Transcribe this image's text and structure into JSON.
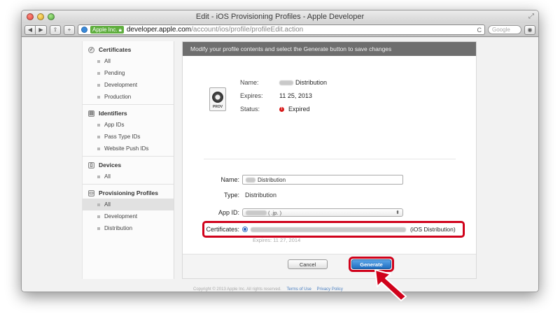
{
  "window": {
    "title": "Edit - iOS Provisioning Profiles - Apple Developer"
  },
  "toolbar": {
    "back_icon": "◀",
    "forward_icon": "▶",
    "share_icon": "⇧",
    "add_icon": "+",
    "ssl_org": "Apple Inc.",
    "url_host": "developer.apple.com",
    "url_path": "/account/ios/profile/profileEdit.action",
    "reload_icon": "C",
    "search_placeholder": "Google",
    "reader_icon": "◉"
  },
  "sidebar": {
    "sections": [
      {
        "title": "Certificates",
        "icon": "certificate-icon",
        "items": [
          "All",
          "Pending",
          "Development",
          "Production"
        ]
      },
      {
        "title": "Identifiers",
        "icon": "id-icon",
        "items": [
          "App IDs",
          "Pass Type IDs",
          "Website Push IDs"
        ]
      },
      {
        "title": "Devices",
        "icon": "device-icon",
        "items": [
          "All"
        ]
      },
      {
        "title": "Provisioning Profiles",
        "icon": "profile-icon",
        "items": [
          "All",
          "Development",
          "Distribution"
        ],
        "active_item": "All"
      }
    ]
  },
  "main": {
    "header": "Modify your profile contents and select the Generate button to save changes",
    "prov_icon_label": "PROV",
    "summary": {
      "name_label": "Name:",
      "name_value": "Distribution",
      "expires_label": "Expires:",
      "expires_value": "11 25, 2013",
      "status_label": "Status:",
      "status_value": "Expired"
    },
    "form": {
      "name_label": "Name:",
      "name_value": "Distribution",
      "type_label": "Type:",
      "type_value": "Distribution",
      "app_id_label": "App ID:",
      "app_id_value": "(                 .jp.                    )",
      "certificates_label": "Certificates:",
      "certificate_type": "(iOS Distribution)",
      "certificate_expires": "Expires: 11 27, 2014"
    },
    "buttons": {
      "cancel": "Cancel",
      "generate": "Generate"
    },
    "footer": {
      "copyright": "Copyright © 2013 Apple Inc. All rights reserved.",
      "terms": "Terms of Use",
      "privacy": "Privacy Policy"
    }
  },
  "colors": {
    "highlight_red": "#d0021b",
    "generate_blue": "#1f6ec0",
    "header_gray": "#6e6e6e"
  }
}
